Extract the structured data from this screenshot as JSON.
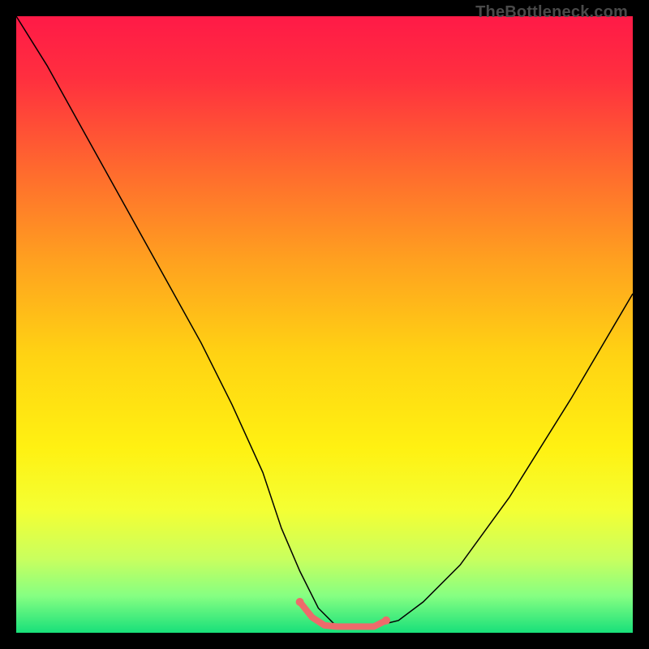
{
  "watermark": "TheBottleneck.com",
  "chart_data": {
    "type": "line",
    "title": "",
    "xlabel": "",
    "ylabel": "",
    "xlim": [
      0,
      100
    ],
    "ylim": [
      0,
      100
    ],
    "grid": false,
    "legend": false,
    "gradient_stops": [
      {
        "offset": 0.0,
        "color": "#ff1a47"
      },
      {
        "offset": 0.1,
        "color": "#ff2f3f"
      },
      {
        "offset": 0.25,
        "color": "#ff6a2e"
      },
      {
        "offset": 0.4,
        "color": "#ffa21f"
      },
      {
        "offset": 0.55,
        "color": "#ffd313"
      },
      {
        "offset": 0.7,
        "color": "#fff112"
      },
      {
        "offset": 0.8,
        "color": "#f4ff33"
      },
      {
        "offset": 0.88,
        "color": "#c9ff5e"
      },
      {
        "offset": 0.94,
        "color": "#86ff82"
      },
      {
        "offset": 1.0,
        "color": "#18e07a"
      }
    ],
    "series": [
      {
        "name": "bottleneck-curve",
        "color": "#000000",
        "stroke_width": 1.5,
        "x": [
          0,
          5,
          10,
          15,
          20,
          25,
          30,
          35,
          40,
          43,
          46,
          49,
          52,
          55,
          58,
          62,
          66,
          72,
          80,
          90,
          100
        ],
        "y": [
          100,
          92,
          83,
          74,
          65,
          56,
          47,
          37,
          26,
          17,
          10,
          4,
          1,
          1,
          1,
          2,
          5,
          11,
          22,
          38,
          55
        ]
      },
      {
        "name": "valley-highlight",
        "color": "#ed6b6b",
        "stroke_width": 8,
        "linecap": "round",
        "x": [
          46,
          48,
          50,
          52,
          54,
          56,
          58,
          60
        ],
        "y": [
          5,
          2.5,
          1.2,
          1,
          1,
          1,
          1,
          2
        ]
      }
    ],
    "valley_dots": {
      "color": "#ed6b6b",
      "r": 5,
      "points": [
        {
          "x": 46,
          "y": 5
        },
        {
          "x": 60,
          "y": 2
        }
      ]
    }
  }
}
